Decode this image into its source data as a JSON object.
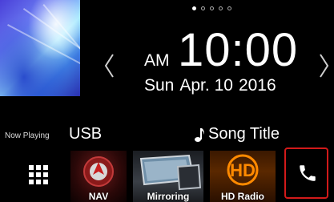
{
  "home": {
    "page_indicator": {
      "count": 5,
      "active_index": 0
    },
    "clock": {
      "ampm": "AM",
      "time": "10:00",
      "weekday": "Sun",
      "date": "Apr. 10",
      "year": "2016"
    },
    "now_playing": {
      "label": "Now Playing",
      "source": "USB",
      "song_title": "Song Title"
    },
    "launcher": {
      "nav_label": "NAV",
      "mirroring_label": "Mirroring",
      "hd_radio_label": "HD Radio"
    },
    "colors": {
      "highlight_border": "#d21a1a",
      "hd_radio_accent": "#ff8a00"
    },
    "icons": [
      "chevron-left-icon",
      "chevron-right-icon",
      "music-note-icon",
      "grid-menu-icon",
      "navigation-icon",
      "mirroring-icon",
      "hd-radio-icon",
      "phone-icon"
    ]
  }
}
